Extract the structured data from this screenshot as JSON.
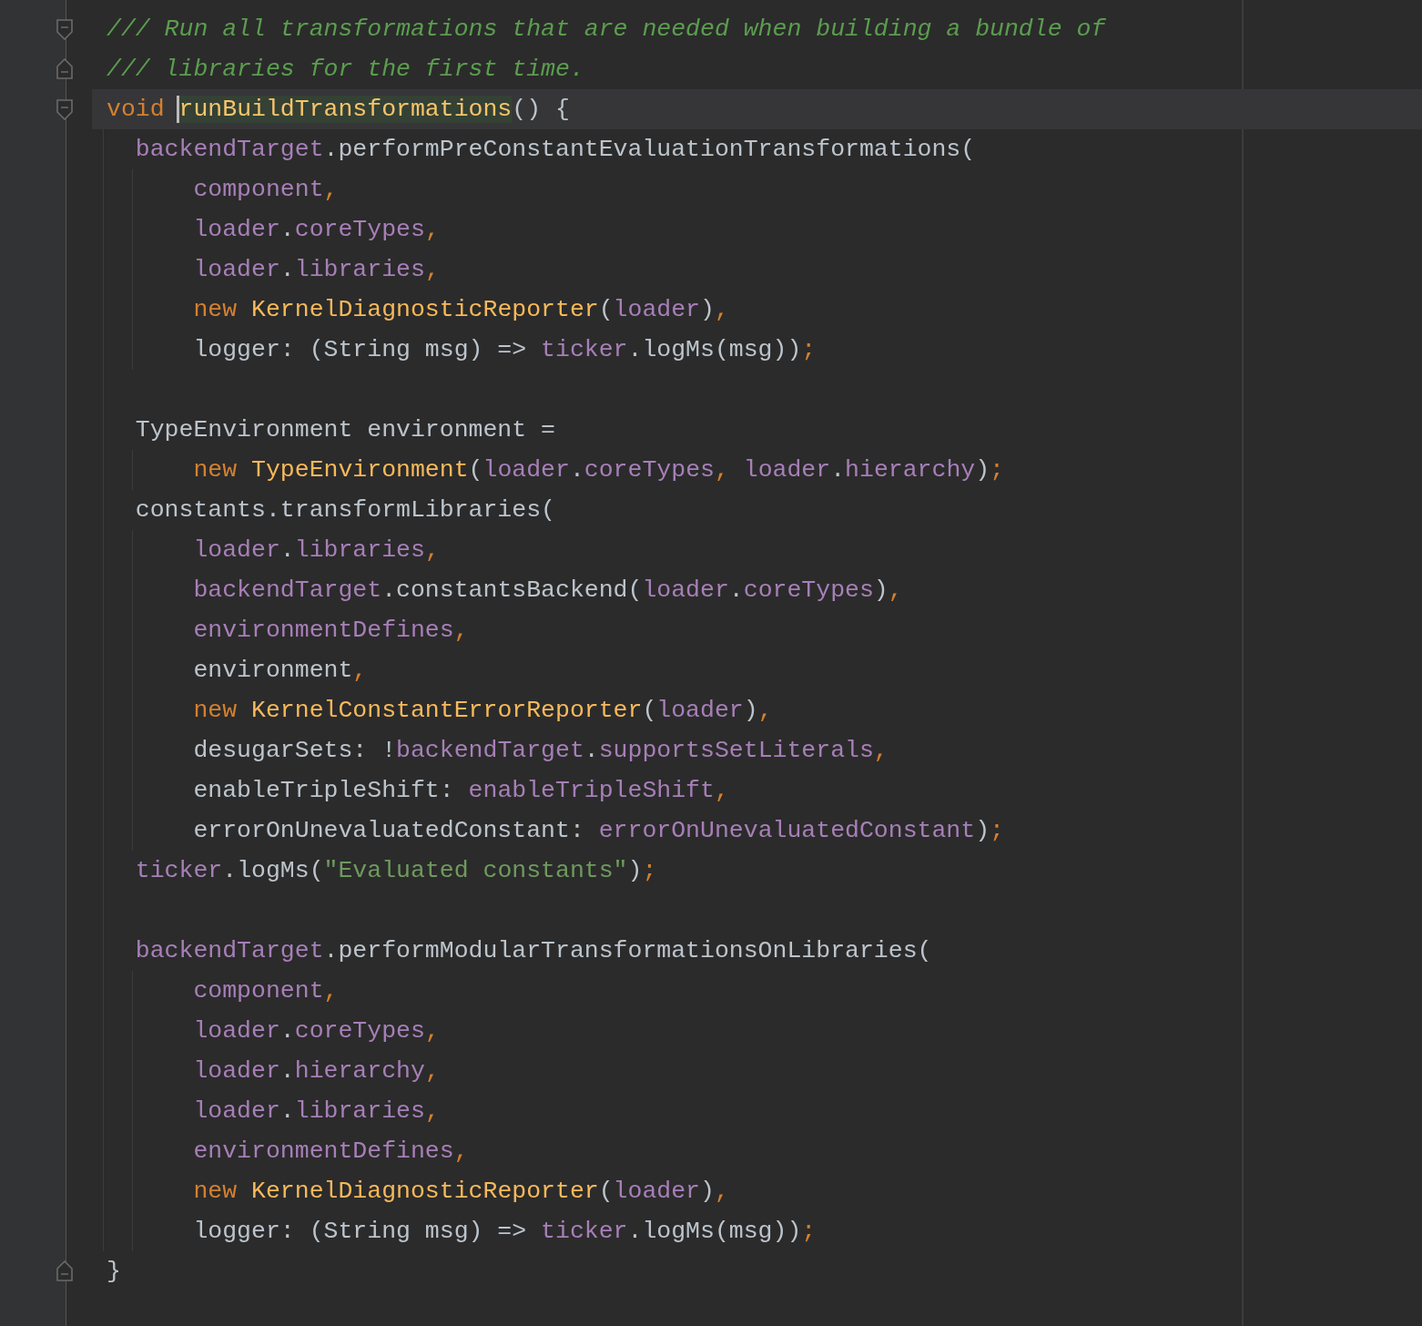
{
  "lines": [
    {
      "kind": "fold_start",
      "current": false,
      "tokens": [
        {
          "kind": "comment",
          "text": "/// Run all transformations that are needed when building a bundle of"
        }
      ]
    },
    {
      "kind": "fold_end",
      "current": false,
      "tokens": [
        {
          "kind": "comment",
          "text": "/// libraries for the first time."
        }
      ]
    },
    {
      "kind": "fold_start",
      "current": true,
      "tokens": [
        {
          "kind": "keyword",
          "text": "void "
        },
        {
          "kind": "declaration",
          "text": "runBuildTransformations",
          "highlighted": true,
          "caret": true
        },
        {
          "kind": "plain",
          "text": "() {"
        }
      ]
    },
    {
      "current": false,
      "tokens": [
        {
          "kind": "field",
          "text": "  backendTarget"
        },
        {
          "kind": "plain",
          "text": ".performPreConstantEvaluationTransformations("
        }
      ]
    },
    {
      "current": false,
      "tokens": [
        {
          "kind": "field",
          "text": "      component"
        },
        {
          "kind": "punct",
          "text": ","
        }
      ]
    },
    {
      "current": false,
      "tokens": [
        {
          "kind": "field",
          "text": "      loader"
        },
        {
          "kind": "plain",
          "text": "."
        },
        {
          "kind": "field",
          "text": "coreTypes"
        },
        {
          "kind": "punct",
          "text": ","
        }
      ]
    },
    {
      "current": false,
      "tokens": [
        {
          "kind": "field",
          "text": "      loader"
        },
        {
          "kind": "plain",
          "text": "."
        },
        {
          "kind": "field",
          "text": "libraries"
        },
        {
          "kind": "punct",
          "text": ","
        }
      ]
    },
    {
      "current": false,
      "tokens": [
        {
          "kind": "keyword",
          "text": "      new "
        },
        {
          "kind": "type",
          "text": "KernelDiagnosticReporter"
        },
        {
          "kind": "plain",
          "text": "("
        },
        {
          "kind": "field",
          "text": "loader"
        },
        {
          "kind": "plain",
          "text": ")"
        },
        {
          "kind": "punct",
          "text": ","
        }
      ]
    },
    {
      "current": false,
      "tokens": [
        {
          "kind": "plain",
          "text": "      logger: (String msg) => "
        },
        {
          "kind": "field",
          "text": "ticker"
        },
        {
          "kind": "plain",
          "text": ".logMs(msg))"
        },
        {
          "kind": "punct",
          "text": ";"
        }
      ]
    },
    {
      "current": false
    },
    {
      "current": false,
      "tokens": [
        {
          "kind": "plain",
          "text": "  TypeEnvironment environment ="
        }
      ]
    },
    {
      "current": false,
      "tokens": [
        {
          "kind": "keyword",
          "text": "      new "
        },
        {
          "kind": "type",
          "text": "TypeEnvironment"
        },
        {
          "kind": "plain",
          "text": "("
        },
        {
          "kind": "field",
          "text": "loader"
        },
        {
          "kind": "plain",
          "text": "."
        },
        {
          "kind": "field",
          "text": "coreTypes"
        },
        {
          "kind": "punct",
          "text": ", "
        },
        {
          "kind": "field",
          "text": "loader"
        },
        {
          "kind": "plain",
          "text": "."
        },
        {
          "kind": "field",
          "text": "hierarchy"
        },
        {
          "kind": "plain",
          "text": ")"
        },
        {
          "kind": "punct",
          "text": ";"
        }
      ]
    },
    {
      "current": false,
      "tokens": [
        {
          "kind": "plain",
          "text": "  constants.transformLibraries("
        }
      ]
    },
    {
      "current": false,
      "tokens": [
        {
          "kind": "field",
          "text": "      loader"
        },
        {
          "kind": "plain",
          "text": "."
        },
        {
          "kind": "field",
          "text": "libraries"
        },
        {
          "kind": "punct",
          "text": ","
        }
      ]
    },
    {
      "current": false,
      "tokens": [
        {
          "kind": "field",
          "text": "      backendTarget"
        },
        {
          "kind": "plain",
          "text": ".constantsBackend("
        },
        {
          "kind": "field",
          "text": "loader"
        },
        {
          "kind": "plain",
          "text": "."
        },
        {
          "kind": "field",
          "text": "coreTypes"
        },
        {
          "kind": "plain",
          "text": ")"
        },
        {
          "kind": "punct",
          "text": ","
        }
      ]
    },
    {
      "current": false,
      "tokens": [
        {
          "kind": "field",
          "text": "      environmentDefines"
        },
        {
          "kind": "punct",
          "text": ","
        }
      ]
    },
    {
      "current": false,
      "tokens": [
        {
          "kind": "plain",
          "text": "      environment"
        },
        {
          "kind": "punct",
          "text": ","
        }
      ]
    },
    {
      "current": false,
      "tokens": [
        {
          "kind": "keyword",
          "text": "      new "
        },
        {
          "kind": "type",
          "text": "KernelConstantErrorReporter"
        },
        {
          "kind": "plain",
          "text": "("
        },
        {
          "kind": "field",
          "text": "loader"
        },
        {
          "kind": "plain",
          "text": ")"
        },
        {
          "kind": "punct",
          "text": ","
        }
      ]
    },
    {
      "current": false,
      "tokens": [
        {
          "kind": "plain",
          "text": "      desugarSets: !"
        },
        {
          "kind": "field",
          "text": "backendTarget"
        },
        {
          "kind": "plain",
          "text": "."
        },
        {
          "kind": "field",
          "text": "supportsSetLiterals"
        },
        {
          "kind": "punct",
          "text": ","
        }
      ]
    },
    {
      "current": false,
      "tokens": [
        {
          "kind": "plain",
          "text": "      enableTripleShift: "
        },
        {
          "kind": "field",
          "text": "enableTripleShift"
        },
        {
          "kind": "punct",
          "text": ","
        }
      ]
    },
    {
      "current": false,
      "tokens": [
        {
          "kind": "plain",
          "text": "      errorOnUnevaluatedConstant: "
        },
        {
          "kind": "field",
          "text": "errorOnUnevaluatedConstant"
        },
        {
          "kind": "plain",
          "text": ")"
        },
        {
          "kind": "punct",
          "text": ";"
        }
      ]
    },
    {
      "current": false,
      "tokens": [
        {
          "kind": "field",
          "text": "  ticker"
        },
        {
          "kind": "plain",
          "text": ".logMs("
        },
        {
          "kind": "string",
          "text": "\"Evaluated constants\""
        },
        {
          "kind": "plain",
          "text": ")"
        },
        {
          "kind": "punct",
          "text": ";"
        }
      ]
    },
    {
      "current": false
    },
    {
      "current": false,
      "tokens": [
        {
          "kind": "field",
          "text": "  backendTarget"
        },
        {
          "kind": "plain",
          "text": ".performModularTransformationsOnLibraries("
        }
      ]
    },
    {
      "current": false,
      "tokens": [
        {
          "kind": "field",
          "text": "      component"
        },
        {
          "kind": "punct",
          "text": ","
        }
      ]
    },
    {
      "current": false,
      "tokens": [
        {
          "kind": "field",
          "text": "      loader"
        },
        {
          "kind": "plain",
          "text": "."
        },
        {
          "kind": "field",
          "text": "coreTypes"
        },
        {
          "kind": "punct",
          "text": ","
        }
      ]
    },
    {
      "current": false,
      "tokens": [
        {
          "kind": "field",
          "text": "      loader"
        },
        {
          "kind": "plain",
          "text": "."
        },
        {
          "kind": "field",
          "text": "hierarchy"
        },
        {
          "kind": "punct",
          "text": ","
        }
      ]
    },
    {
      "current": false,
      "tokens": [
        {
          "kind": "field",
          "text": "      loader"
        },
        {
          "kind": "plain",
          "text": "."
        },
        {
          "kind": "field",
          "text": "libraries"
        },
        {
          "kind": "punct",
          "text": ","
        }
      ]
    },
    {
      "current": false,
      "tokens": [
        {
          "kind": "field",
          "text": "      environmentDefines"
        },
        {
          "kind": "punct",
          "text": ","
        }
      ]
    },
    {
      "current": false,
      "tokens": [
        {
          "kind": "keyword",
          "text": "      new "
        },
        {
          "kind": "type",
          "text": "KernelDiagnosticReporter"
        },
        {
          "kind": "plain",
          "text": "("
        },
        {
          "kind": "field",
          "text": "loader"
        },
        {
          "kind": "plain",
          "text": ")"
        },
        {
          "kind": "punct",
          "text": ","
        }
      ]
    },
    {
      "current": false,
      "tokens": [
        {
          "kind": "plain",
          "text": "      logger: (String msg) => "
        },
        {
          "kind": "field",
          "text": "ticker"
        },
        {
          "kind": "plain",
          "text": ".logMs(msg))"
        },
        {
          "kind": "punct",
          "text": ";"
        }
      ]
    },
    {
      "kind": "fold_end",
      "current": false,
      "tokens": [
        {
          "kind": "plain",
          "text": "}"
        }
      ]
    }
  ]
}
